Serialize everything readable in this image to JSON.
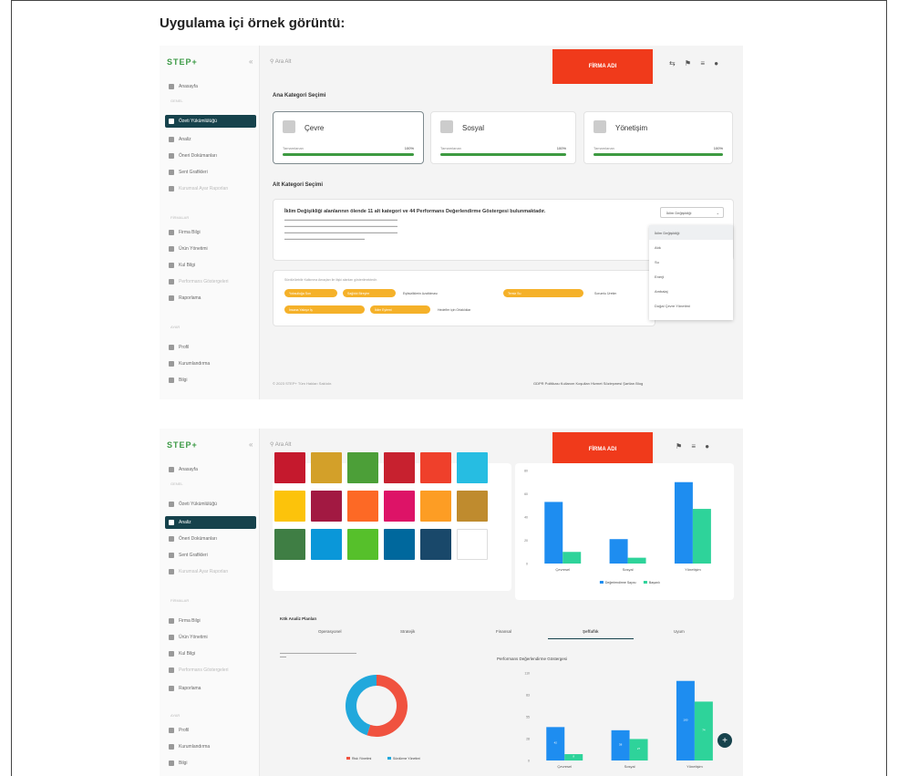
{
  "caption": "Uygulama içi örnek görüntü:",
  "app": {
    "logo": "STEP+",
    "firm_button": "FİRMA ADI",
    "search_placeholder": "Ara Alt"
  },
  "sidebar": {
    "items": [
      {
        "label": "Anasayfa"
      },
      {
        "label": "Özeti Yükümlülüğü"
      },
      {
        "label": "Analiz"
      },
      {
        "label": "Öneri Dokümanları"
      },
      {
        "label": "Sent Grafikleri"
      },
      {
        "label": "Kurumsal Ayar Raporları"
      },
      {
        "label": "Firma Bilgi"
      },
      {
        "label": "Ürün Yönetimi"
      },
      {
        "label": "Kul Bilgi"
      },
      {
        "label": "Performans Göstergeleri"
      },
      {
        "label": "Raporlama"
      },
      {
        "label": "Profil"
      },
      {
        "label": "Kurumlandırma"
      },
      {
        "label": "Bilgi"
      }
    ],
    "sections": [
      "GENEL",
      "FİRMALAR",
      "AYAR"
    ]
  },
  "screen1": {
    "main_category_heading": "Ana Kategori Seçimi",
    "categories": [
      {
        "name": "Çevre",
        "left_label": "Tamamlanan",
        "pct": "100%"
      },
      {
        "name": "Sosyal",
        "left_label": "Tamamlanan",
        "pct": "100%"
      },
      {
        "name": "Yönetişim",
        "left_label": "Tamamlanan",
        "pct": "100%"
      }
    ],
    "sub_category_heading": "Alt Kategori Seçimi",
    "card_title": "İklim Değişikliği alanlarının ölende 11 alt kategori ve 44 Performans Değerlendirme Göstergesi bulunmaktadır.",
    "dropdown_selected": "İklim Değişikliği",
    "dropdown_options": [
      "İklim Değişikliği",
      "Atık",
      "Su",
      "Enerji",
      "Ambalaj",
      "Doğal Çevre Yönetimi"
    ],
    "goals_text": "Sürdürülebilir Kalkınma Amaçları ile ilişki alanları gösterilmektedir.",
    "chips": [
      "Yoksulluğa Son",
      "Sağlıklı Bireyler",
      "Temiz Su",
      "Erişilebilir Enerji",
      "İnsana Yakışır İş",
      "Sanayi ve Altyapı",
      "Sürdürülebilir Şehirler",
      "İklim Eylemi"
    ],
    "plain_chips": [
      "Eşitsizliklerin Azaltılması",
      "Sorumlu Üretim",
      "Hedefler için Ortaklıklar"
    ],
    "footer_left": "© 2023 STEP+ Tüm Hakları Saklıdır.",
    "footer_right": "GDPR Politikası   Kullanım Koşulları   Hizmet Sözleşmesi Şartları   Blog"
  },
  "screen2": {
    "sdg_colors": [
      "#c5192d",
      "#d3a029",
      "#4c9f38",
      "#c7212f",
      "#ef402b",
      "#26bde2",
      "#fcc30b",
      "#a21942",
      "#fd6925",
      "#dd1367",
      "#fd9d24",
      "#bf8b2e",
      "#3f7e44",
      "#0a97d9",
      "#56c02b",
      "#00689d",
      "#19486a",
      "#ffffff"
    ],
    "tabs": [
      "Operasyonel",
      "Stratejik",
      "Finansal",
      "Şeffaflık",
      "Uyum"
    ],
    "section_title": "Kök Analiz Planları",
    "donut_legend": [
      "Risk Yönetimi",
      "Sürdürme Yönetimi"
    ],
    "perf_title": "Performans Değerlendirme Göstergesi"
  },
  "chart_data": [
    {
      "type": "bar",
      "categories": [
        "Çevresel",
        "Sosyal",
        "Yönetişim"
      ],
      "series": [
        {
          "name": "Değerlendirme Sayısı",
          "values": [
            53,
            21,
            70
          ]
        },
        {
          "name": "Başarılı",
          "values": [
            10,
            5,
            47
          ]
        }
      ],
      "ylim": [
        0,
        80
      ],
      "colors": [
        "#1e8df0",
        "#2ed39a"
      ]
    },
    {
      "type": "bar",
      "title": "Performans Değerlendirme Göstergesi",
      "categories": [
        "Çevresel",
        "Sosyal",
        "Yönetişim"
      ],
      "series": [
        {
          "name": "Değerlendirme Sayısı",
          "values": [
            42,
            38,
            100
          ]
        },
        {
          "name": "Başarılı",
          "values": [
            8,
            27,
            74
          ]
        }
      ],
      "ylim": [
        0,
        110
      ],
      "colors": [
        "#1e8df0",
        "#2ed39a"
      ]
    },
    {
      "type": "pie",
      "categories": [
        "Risk Yönetimi",
        "Sürdürme Yönetimi"
      ],
      "values": [
        55,
        45
      ],
      "colors": [
        "#f0523f",
        "#21a8dc"
      ]
    }
  ]
}
